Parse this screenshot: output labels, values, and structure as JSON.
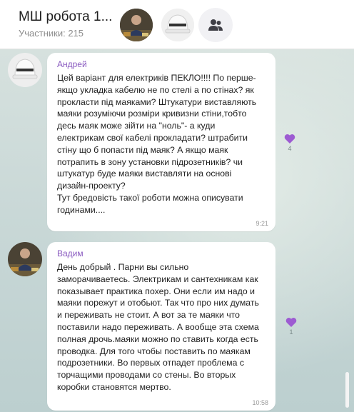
{
  "header": {
    "title": "МШ робота 1...",
    "subtitle": "Участники: 215"
  },
  "icons": {
    "members": "group-members-icon",
    "reaction": "heart-icon"
  },
  "colors": {
    "sender_name": "#8a5bc0",
    "reaction_heart": "#9d5bd2",
    "chat_background": "#c9d8d7"
  },
  "messages": [
    {
      "sender": "Андрей",
      "text": "Цей варіант для електриків ПЕКЛО!!!! По перше- якщо укладка кабелю не по стелі а по стінах? як прокласти під маяками? Штукатури виставляють маяки розуміючи розміри кривизни стіни,тобто десь маяк може зійти на \"ноль\"- а куди електрикам свої кабелі прокладати? штрабити стіну що б попасти під маяк? А якщо маяк потрапить в зону установки підрозетників? чи штукатур буде маяки виставляти на основі дизайн-проекту?\n Тут бредовість такої роботи можна описувати годинами....",
      "time": "9:21",
      "reaction_count": "4"
    },
    {
      "sender": "Вадим",
      "text": "День добрый . Парни вы сильно заморачиваетесь.  Электрикам и сантехникам как показывает практика похер. Они если им надо и маяки порежут и отобьют. Так что про них думать и переживать не стоит. А вот за те маяки что поставили надо переживать. А вообще эта схема полная дрочь.маяки можно по ставить когда есть проводка. Для того чтобы поставить по маякам подрозетники. Во первых отпадет проблема с торчащими проводами со стены. Во вторых коробки становятся мертво.",
      "time": "10:58",
      "reaction_count": "1"
    }
  ]
}
